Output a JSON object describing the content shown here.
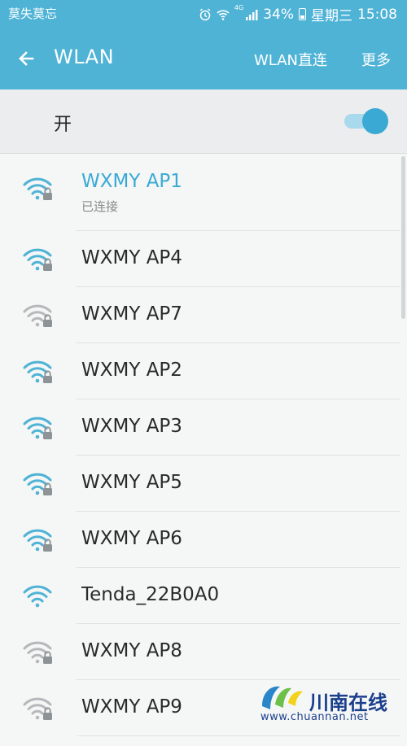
{
  "status_bar": {
    "carrier": "莫失莫忘",
    "network": "4G",
    "battery": "34%",
    "day": "星期三",
    "time": "15:08"
  },
  "app_bar": {
    "title": "WLAN",
    "direct_label": "WLAN直连",
    "more_label": "更多"
  },
  "wlan_toggle": {
    "label": "开",
    "state": "on"
  },
  "networks": [
    {
      "name": "WXMY AP1",
      "status": "已连接",
      "signal": 3,
      "secured": true
    },
    {
      "name": "WXMY AP4",
      "signal": 3,
      "secured": true
    },
    {
      "name": "WXMY AP7",
      "signal": 1,
      "secured": true
    },
    {
      "name": "WXMY AP2",
      "signal": 3,
      "secured": true
    },
    {
      "name": "WXMY AP3",
      "signal": 3,
      "secured": true
    },
    {
      "name": "WXMY AP5",
      "signal": 3,
      "secured": true
    },
    {
      "name": "WXMY AP6",
      "signal": 3,
      "secured": true
    },
    {
      "name": "Tenda_22B0A0",
      "signal": 3,
      "secured": false
    },
    {
      "name": "WXMY AP8",
      "signal": 1,
      "secured": true
    },
    {
      "name": "WXMY AP9",
      "signal": 1,
      "secured": true
    }
  ],
  "colors": {
    "accent": "#4fb3d6",
    "connected_text": "#3aaad4",
    "wifi_strong": "#4fb3d6",
    "wifi_weak": "#b5b9bb"
  },
  "watermark": {
    "name": "川南在线",
    "url": "www.chuannan.net"
  }
}
